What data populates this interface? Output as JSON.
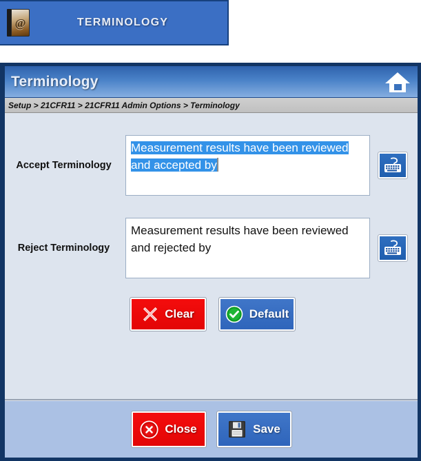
{
  "banner": {
    "title": "TERMINOLOGY",
    "icon": "address-book-at-icon"
  },
  "window": {
    "title": "Terminology",
    "home_icon": "home-icon",
    "breadcrumb": "Setup > 21CFR11 > 21CFR11 Admin Options > Terminology"
  },
  "fields": [
    {
      "label": "Accept Terminology",
      "value": "Measurement results have been reviewed and accepted by",
      "selected": true,
      "keyboard_icon": "keyboard-icon"
    },
    {
      "label": "Reject Terminology",
      "value": "Measurement results have been reviewed and rejected by",
      "selected": false,
      "keyboard_icon": "keyboard-icon"
    }
  ],
  "mid_buttons": [
    {
      "label": "Clear",
      "icon": "cross-x-icon",
      "style": "red"
    },
    {
      "label": "Default",
      "icon": "check-circle-icon",
      "style": "blue"
    }
  ],
  "footer_buttons": [
    {
      "label": "Close",
      "icon": "close-circle-icon",
      "style": "red"
    },
    {
      "label": "Save",
      "icon": "floppy-disk-icon",
      "style": "blue"
    }
  ],
  "colors": {
    "banner_blue": "#3b6fc4",
    "border_navy": "#123564",
    "content_bg": "#dde4ee",
    "footer_bg": "#abc1e4",
    "breadcrumb_bg": "#c5c5c5",
    "selection_blue": "#3392e8",
    "button_red": "#e30505",
    "button_blue": "#3569bd"
  }
}
